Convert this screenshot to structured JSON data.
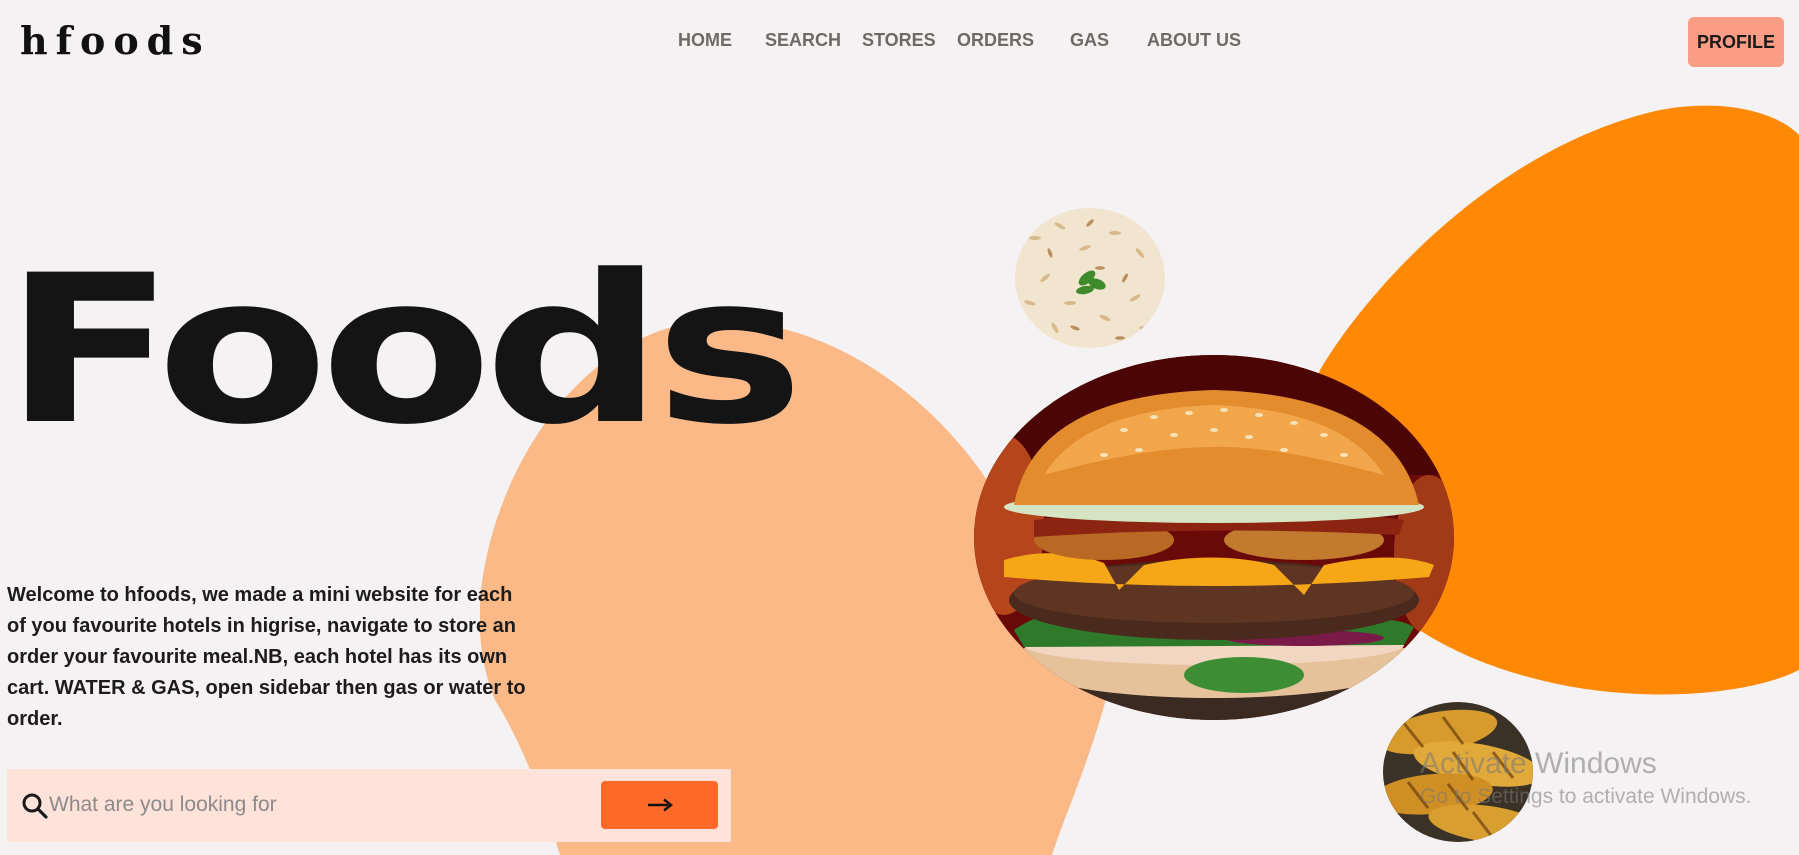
{
  "header": {
    "logo": "hfoods",
    "nav": [
      {
        "label": "HOME"
      },
      {
        "label": "SEARCH"
      },
      {
        "label": "STORES"
      },
      {
        "label": "ORDERS"
      },
      {
        "label": "GAS"
      },
      {
        "label": "ABOUT US"
      }
    ],
    "profile_label": "PROFILE"
  },
  "hero": {
    "title": "Foods",
    "description": "Welcome to hfoods, we made a mini website for each of you favourite hotels in higrise, navigate to store an order your favourite meal.NB, each hotel has its own cart. WATER & GAS, open sidebar then gas or water to order."
  },
  "search": {
    "placeholder": "What are you looking for",
    "value": ""
  },
  "images": {
    "rice": "rice-dish-image",
    "burger": "cheeseburger-image",
    "potato": "grilled-potatoes-image"
  },
  "watermark": {
    "title": "Activate Windows",
    "subtitle": "Go to Settings to activate Windows."
  },
  "colors": {
    "background": "#f4f2f2",
    "orange_blob": "#ff8904",
    "peach_blob": "#fbb988",
    "profile_button": "#fb9c84",
    "search_bar": "#ffe2d9",
    "search_button": "#ff6a2b"
  }
}
